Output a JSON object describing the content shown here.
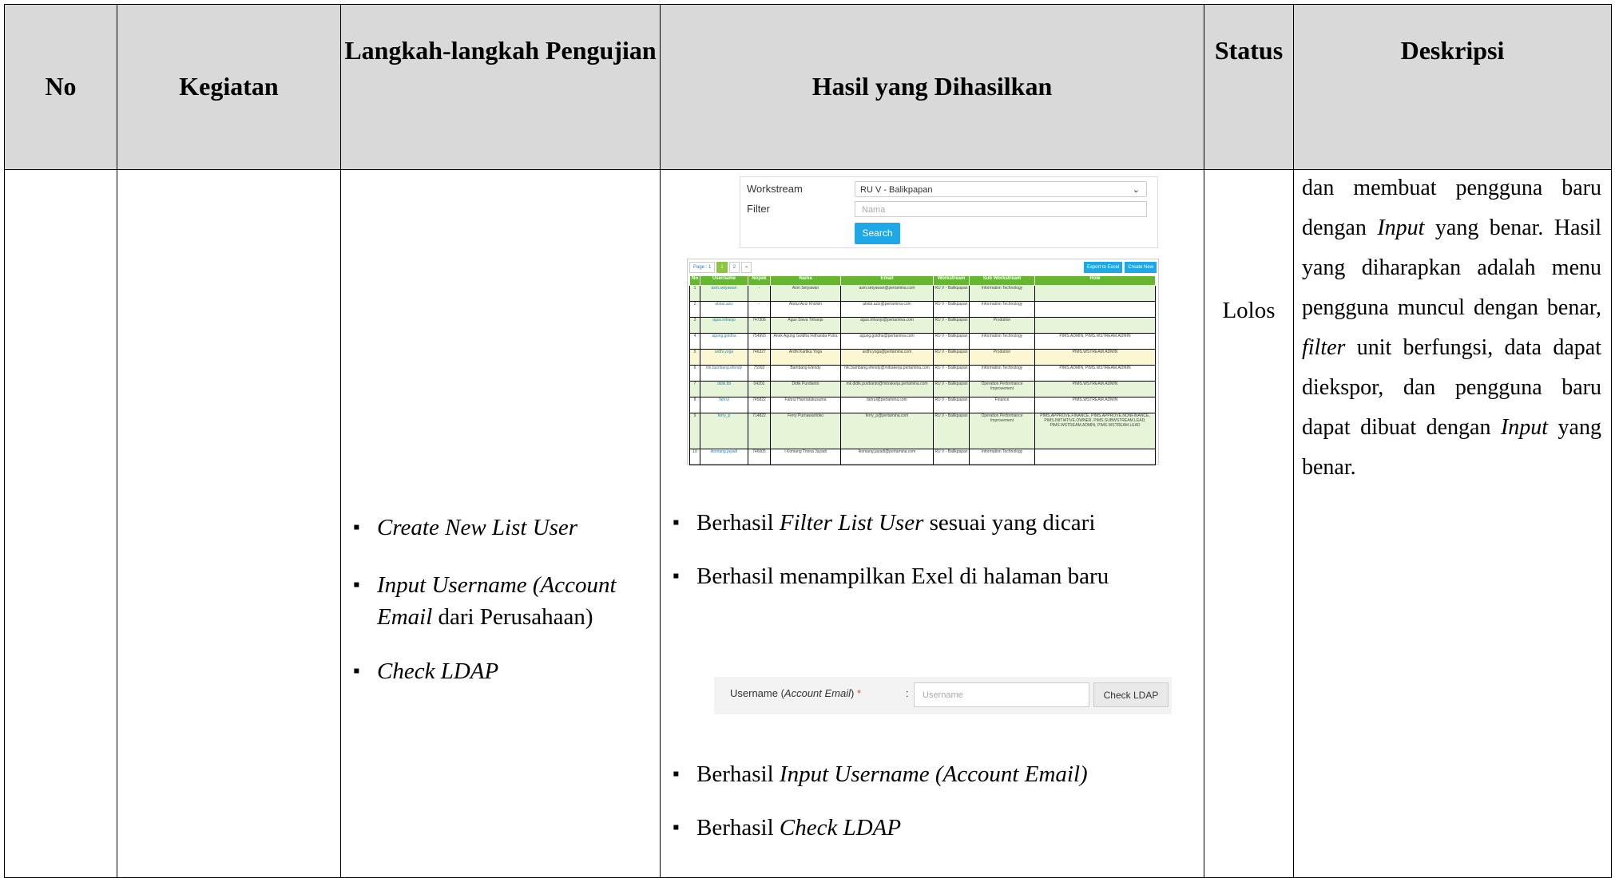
{
  "header": {
    "no": "No",
    "kegiatan": "Kegiatan",
    "langkah": "Langkah-langkah Pengujian",
    "hasil": "Hasil yang Dihasilkan",
    "status": "Status",
    "deskripsi": "Deskripsi"
  },
  "row": {
    "langkah_items": [
      {
        "italic": "Create New List User",
        "rest": ""
      },
      {
        "italic": "Input Username (Account Email",
        "rest": " dari Perusahaan)"
      },
      {
        "italic": "Check LDAP",
        "rest": ""
      }
    ],
    "status": "Lolos",
    "deskripsi_parts": [
      "dan membuat pengguna baru dengan ",
      "Input",
      " yang benar. Hasil yang diharapkan adalah menu pengguna muncul dengan benar, ",
      "filter",
      " unit berfungsi, data dapat diekspor, dan pengguna baru dapat dibuat dengan ",
      "Input",
      " yang benar."
    ],
    "hasil_bullets_1": [
      {
        "pre": "Berhasil ",
        "italic": "Filter List User",
        "post": " sesuai yang dicari"
      },
      {
        "pre": "Berhasil menampilkan Exel di halaman baru",
        "italic": "",
        "post": ""
      }
    ],
    "hasil_bullets_2": [
      {
        "pre": "Berhasil ",
        "italic": "Input Username (Account Email)",
        "post": ""
      },
      {
        "pre": "Berhasil ",
        "italic": "Check LDAP",
        "post": ""
      }
    ]
  },
  "filter_form": {
    "workstream_label": "Workstream",
    "workstream_value": "RU V - Balikpapan",
    "filter_label": "Filter",
    "filter_placeholder": "Nama",
    "search_button": "Search"
  },
  "user_table": {
    "pager": [
      "Page : 1",
      "1",
      "2",
      "»"
    ],
    "buttons": [
      "Export to Excel",
      "Create New"
    ],
    "columns": [
      "No",
      "Username",
      "Nopek",
      "Nama",
      "Email",
      "Workstream",
      "Sub Workstream",
      "Role"
    ],
    "rows": [
      {
        "cells": [
          "1",
          "asm.setyawan",
          "-",
          "Asm Setyawan",
          "asm.setyawan@pertamina.com",
          "RU V - Balikpapan",
          "Information Technology",
          ""
        ],
        "tone": "green"
      },
      {
        "cells": [
          "2",
          "abdul.aziz",
          "-",
          "Abdul Aziz Kholish",
          "abdul.aziz@pertamina.com",
          "RU V - Balikpapan",
          "Information Technology",
          ""
        ],
        "tone": ""
      },
      {
        "cells": [
          "3",
          "agus.trihanjo",
          "747306",
          "Agus Sisva Trihanjo",
          "agus.trihanjo@pertamina.com",
          "RU V - Balikpapan",
          "Prodution",
          ""
        ],
        "tone": "green"
      },
      {
        "cells": [
          "4",
          "agung.goldha",
          "754993",
          "Anek Agung Goldha Fidhanda Putra",
          "agung.goldha@pertamina.com",
          "RU V - Balikpapan",
          "Information Technology",
          "PIMS.ADMIN, PIMS.WSTREAM.ADMIN"
        ],
        "tone": ""
      },
      {
        "cells": [
          "5",
          "ardhi.yoga",
          "746327",
          "Ardhi Kartika Yoga",
          "ardhi.yoga@pertamina.com",
          "RU V - Balikpapan",
          "Prodution",
          "PIMS.WSTREAM.ADMIN"
        ],
        "tone": "yellow"
      },
      {
        "cells": [
          "6",
          "mk.bambang.efendy",
          "75992",
          "Bambang Efendy",
          "mk.bambang.efendy@mitrakerja.pertamina.com",
          "RU V - Balikpapan",
          "Information Technology",
          "PIMS.ADMIN, PIMS.WSTREAM.ADMIN"
        ],
        "tone": ""
      },
      {
        "cells": [
          "7",
          "didik.tbl",
          "04202",
          "Didik Purdianto",
          "mk.didik.purdianto@mitrakerja.pertamina.com",
          "RU V - Balikpapan",
          "Operation Performance Improvement",
          "PIMS.WSTREAM.ADMIN"
        ],
        "tone": "green"
      },
      {
        "cells": [
          "8",
          "fahrul",
          "745822",
          "Fahrul Hanriatakusuma",
          "fahrul@pertamina.com",
          "RU V - Balikpapan",
          "Finance",
          "PIMS.WSTREAM.ADMIN"
        ],
        "tone": ""
      },
      {
        "cells": [
          "9",
          "ferry_p",
          "714822",
          "Ferry Purnawantoko",
          "ferry_p@pertamina.com",
          "RU V - Balikpapan",
          "Operation Performance Improvement",
          "PIMS.APPROVE.FINANCE, PIMS.APPROVE.NONFINANCE, PIMS.INITIATIVE.OWNER, PIMS.SUBWSTREAM.LEAD, PIMS.WSTREAM.ADMIN, PIMS.WSTREAM.LEAD"
        ],
        "tone": "green tall"
      },
      {
        "cells": [
          "10",
          "ikomang.jayadi",
          "746005",
          "I Komang Triona Jayadi",
          "ikomang.jayadi@pertamina.com",
          "RU V - Balikpapan",
          "Information Technology",
          ""
        ],
        "tone": ""
      }
    ]
  },
  "ldap_form": {
    "label_pre": "Username (",
    "label_italic": "Account Email",
    "label_post": ") ",
    "required_mark": "*",
    "colon": ":",
    "input_placeholder": "Username",
    "check_button": "Check LDAP"
  }
}
